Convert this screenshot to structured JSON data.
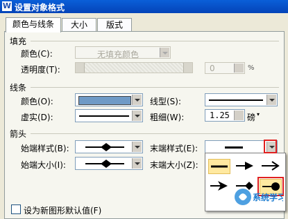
{
  "window": {
    "app_icon": "W",
    "title": "设置对象格式"
  },
  "tabs": [
    {
      "label": "颜色与线条",
      "active": true
    },
    {
      "label": "大小",
      "active": false
    },
    {
      "label": "版式",
      "active": false
    }
  ],
  "fill": {
    "section": "填充",
    "color_label": "颜色(C):",
    "color_value": "无填充颜色",
    "transparency_label": "透明度(T):",
    "transparency_value": "0",
    "transparency_unit": "%"
  },
  "line": {
    "section": "线条",
    "color_label": "颜色(O):",
    "color_value_hex": "#6f9ac6",
    "style_label": "线型(S):",
    "dash_label": "虚实(D):",
    "weight_label": "粗细(W):",
    "weight_value": "1.25",
    "weight_unit": "磅"
  },
  "arrows": {
    "section": "箭头",
    "begin_style_label": "始端样式(B):",
    "end_style_label": "末端样式(E):",
    "begin_size_label": "始端大小(I):",
    "end_size_label": "末端大小(Z):",
    "popup_options": [
      "line",
      "arrow",
      "open-arrow",
      "stealth-arrow",
      "diamond-arrow",
      "oval-arrow"
    ],
    "selected_option": "oval-arrow"
  },
  "footer": {
    "partial_label": "设为新图形默认值(F)"
  },
  "watermark": "系统学习"
}
